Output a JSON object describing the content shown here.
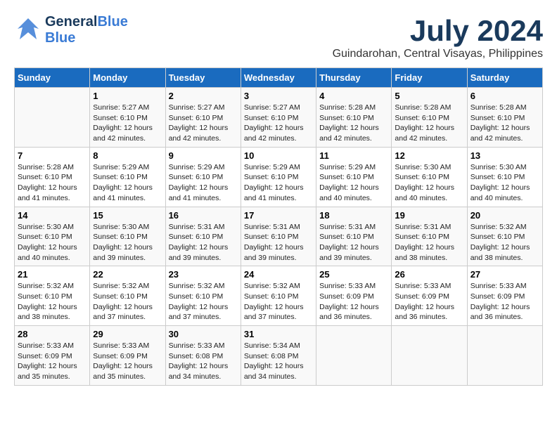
{
  "header": {
    "logo_general": "General",
    "logo_blue": "Blue",
    "title": "July 2024",
    "subtitle": "Guindarohan, Central Visayas, Philippines"
  },
  "calendar": {
    "days_of_week": [
      "Sunday",
      "Monday",
      "Tuesday",
      "Wednesday",
      "Thursday",
      "Friday",
      "Saturday"
    ],
    "weeks": [
      [
        {
          "day": "",
          "info": ""
        },
        {
          "day": "1",
          "info": "Sunrise: 5:27 AM\nSunset: 6:10 PM\nDaylight: 12 hours\nand 42 minutes."
        },
        {
          "day": "2",
          "info": "Sunrise: 5:27 AM\nSunset: 6:10 PM\nDaylight: 12 hours\nand 42 minutes."
        },
        {
          "day": "3",
          "info": "Sunrise: 5:27 AM\nSunset: 6:10 PM\nDaylight: 12 hours\nand 42 minutes."
        },
        {
          "day": "4",
          "info": "Sunrise: 5:28 AM\nSunset: 6:10 PM\nDaylight: 12 hours\nand 42 minutes."
        },
        {
          "day": "5",
          "info": "Sunrise: 5:28 AM\nSunset: 6:10 PM\nDaylight: 12 hours\nand 42 minutes."
        },
        {
          "day": "6",
          "info": "Sunrise: 5:28 AM\nSunset: 6:10 PM\nDaylight: 12 hours\nand 42 minutes."
        }
      ],
      [
        {
          "day": "7",
          "info": "Sunrise: 5:28 AM\nSunset: 6:10 PM\nDaylight: 12 hours\nand 41 minutes."
        },
        {
          "day": "8",
          "info": "Sunrise: 5:29 AM\nSunset: 6:10 PM\nDaylight: 12 hours\nand 41 minutes."
        },
        {
          "day": "9",
          "info": "Sunrise: 5:29 AM\nSunset: 6:10 PM\nDaylight: 12 hours\nand 41 minutes."
        },
        {
          "day": "10",
          "info": "Sunrise: 5:29 AM\nSunset: 6:10 PM\nDaylight: 12 hours\nand 41 minutes."
        },
        {
          "day": "11",
          "info": "Sunrise: 5:29 AM\nSunset: 6:10 PM\nDaylight: 12 hours\nand 40 minutes."
        },
        {
          "day": "12",
          "info": "Sunrise: 5:30 AM\nSunset: 6:10 PM\nDaylight: 12 hours\nand 40 minutes."
        },
        {
          "day": "13",
          "info": "Sunrise: 5:30 AM\nSunset: 6:10 PM\nDaylight: 12 hours\nand 40 minutes."
        }
      ],
      [
        {
          "day": "14",
          "info": "Sunrise: 5:30 AM\nSunset: 6:10 PM\nDaylight: 12 hours\nand 40 minutes."
        },
        {
          "day": "15",
          "info": "Sunrise: 5:30 AM\nSunset: 6:10 PM\nDaylight: 12 hours\nand 39 minutes."
        },
        {
          "day": "16",
          "info": "Sunrise: 5:31 AM\nSunset: 6:10 PM\nDaylight: 12 hours\nand 39 minutes."
        },
        {
          "day": "17",
          "info": "Sunrise: 5:31 AM\nSunset: 6:10 PM\nDaylight: 12 hours\nand 39 minutes."
        },
        {
          "day": "18",
          "info": "Sunrise: 5:31 AM\nSunset: 6:10 PM\nDaylight: 12 hours\nand 39 minutes."
        },
        {
          "day": "19",
          "info": "Sunrise: 5:31 AM\nSunset: 6:10 PM\nDaylight: 12 hours\nand 38 minutes."
        },
        {
          "day": "20",
          "info": "Sunrise: 5:32 AM\nSunset: 6:10 PM\nDaylight: 12 hours\nand 38 minutes."
        }
      ],
      [
        {
          "day": "21",
          "info": "Sunrise: 5:32 AM\nSunset: 6:10 PM\nDaylight: 12 hours\nand 38 minutes."
        },
        {
          "day": "22",
          "info": "Sunrise: 5:32 AM\nSunset: 6:10 PM\nDaylight: 12 hours\nand 37 minutes."
        },
        {
          "day": "23",
          "info": "Sunrise: 5:32 AM\nSunset: 6:10 PM\nDaylight: 12 hours\nand 37 minutes."
        },
        {
          "day": "24",
          "info": "Sunrise: 5:32 AM\nSunset: 6:10 PM\nDaylight: 12 hours\nand 37 minutes."
        },
        {
          "day": "25",
          "info": "Sunrise: 5:33 AM\nSunset: 6:09 PM\nDaylight: 12 hours\nand 36 minutes."
        },
        {
          "day": "26",
          "info": "Sunrise: 5:33 AM\nSunset: 6:09 PM\nDaylight: 12 hours\nand 36 minutes."
        },
        {
          "day": "27",
          "info": "Sunrise: 5:33 AM\nSunset: 6:09 PM\nDaylight: 12 hours\nand 36 minutes."
        }
      ],
      [
        {
          "day": "28",
          "info": "Sunrise: 5:33 AM\nSunset: 6:09 PM\nDaylight: 12 hours\nand 35 minutes."
        },
        {
          "day": "29",
          "info": "Sunrise: 5:33 AM\nSunset: 6:09 PM\nDaylight: 12 hours\nand 35 minutes."
        },
        {
          "day": "30",
          "info": "Sunrise: 5:33 AM\nSunset: 6:08 PM\nDaylight: 12 hours\nand 34 minutes."
        },
        {
          "day": "31",
          "info": "Sunrise: 5:34 AM\nSunset: 6:08 PM\nDaylight: 12 hours\nand 34 minutes."
        },
        {
          "day": "",
          "info": ""
        },
        {
          "day": "",
          "info": ""
        },
        {
          "day": "",
          "info": ""
        }
      ]
    ]
  }
}
